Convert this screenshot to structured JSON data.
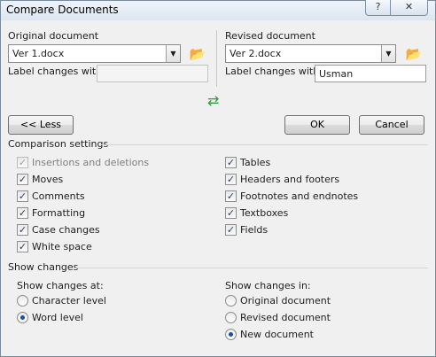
{
  "window": {
    "title": "Compare Documents",
    "help_label": "?",
    "close_label": "✕"
  },
  "original": {
    "heading": "Original document",
    "file": "Ver 1.docx",
    "label_caption": "Label changes with",
    "label_value": ""
  },
  "revised": {
    "heading": "Revised document",
    "file": "Ver 2.docx",
    "label_caption": "Label changes with",
    "label_value": "Usman"
  },
  "buttons": {
    "less": "<< Less",
    "ok": "OK",
    "cancel": "Cancel"
  },
  "comparison": {
    "title": "Comparison settings",
    "left": [
      {
        "label": "Insertions and deletions",
        "checked": true,
        "disabled": true
      },
      {
        "label": "Moves",
        "checked": true,
        "disabled": false
      },
      {
        "label": "Comments",
        "checked": true,
        "disabled": false
      },
      {
        "label": "Formatting",
        "checked": true,
        "disabled": false
      },
      {
        "label": "Case changes",
        "checked": true,
        "disabled": false
      },
      {
        "label": "White space",
        "checked": true,
        "disabled": false
      }
    ],
    "right": [
      {
        "label": "Tables",
        "checked": true,
        "disabled": false
      },
      {
        "label": "Headers and footers",
        "checked": true,
        "disabled": false
      },
      {
        "label": "Footnotes and endnotes",
        "checked": true,
        "disabled": false
      },
      {
        "label": "Textboxes",
        "checked": true,
        "disabled": false
      },
      {
        "label": "Fields",
        "checked": true,
        "disabled": false
      }
    ]
  },
  "show_changes": {
    "title": "Show changes",
    "at_title": "Show changes at:",
    "at_options": [
      {
        "label": "Character level",
        "selected": false
      },
      {
        "label": "Word level",
        "selected": true
      }
    ],
    "in_title": "Show changes in:",
    "in_options": [
      {
        "label": "Original document",
        "selected": false
      },
      {
        "label": "Revised document",
        "selected": false
      },
      {
        "label": "New document",
        "selected": true
      }
    ]
  },
  "icons": {
    "dropdown": "chevron-down-icon",
    "folder": "folder-open-icon",
    "swap": "swap-arrows-icon",
    "check": "check-icon"
  }
}
